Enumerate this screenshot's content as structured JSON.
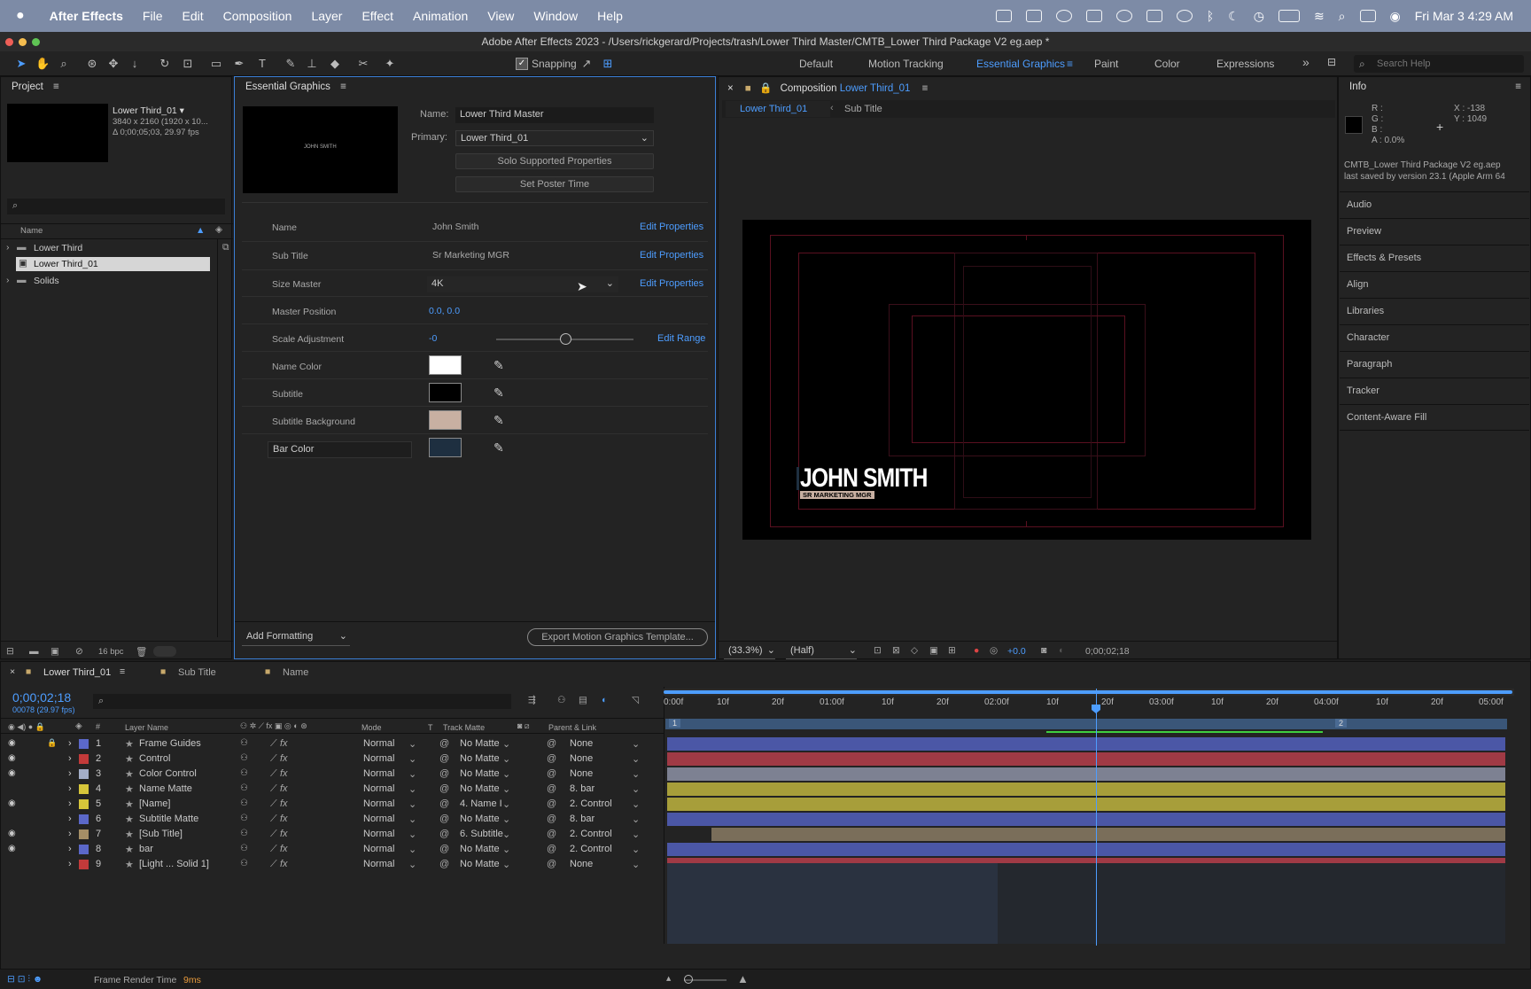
{
  "menubar": {
    "app_name": "After Effects",
    "items": [
      "File",
      "Edit",
      "Composition",
      "Layer",
      "Effect",
      "Animation",
      "View",
      "Window",
      "Help"
    ],
    "datetime": "Fri Mar 3  4:29 AM"
  },
  "window": {
    "title": "Adobe After Effects 2023 - /Users/rickgerard/Projects/trash/Lower Third Master/CMTB_Lower Third Package V2 eg.aep *"
  },
  "toolbar": {
    "snapping_label": "Snapping",
    "workspaces": [
      "Default",
      "Motion Tracking",
      "Essential Graphics",
      "Paint",
      "Color",
      "Expressions"
    ],
    "active_workspace": "Essential Graphics",
    "search_placeholder": "Search Help"
  },
  "project": {
    "title": "Project",
    "selected_name": "Lower Third_01 ▾",
    "selected_res": "3840 x 2160  (1920 x 10...",
    "selected_dur": "Δ 0;00;05;03, 29.97 fps",
    "col_name": "Name",
    "items": [
      {
        "name": "Lower Third",
        "kind": "folder"
      },
      {
        "name": "Lower Third_01",
        "kind": "comp"
      },
      {
        "name": "Solids",
        "kind": "folder"
      }
    ],
    "bpc": "16 bpc"
  },
  "essential_graphics": {
    "title": "Essential Graphics",
    "name_label": "Name:",
    "name_value": "Lower Third Master",
    "primary_label": "Primary:",
    "primary_value": "Lower Third_01",
    "solo_button": "Solo Supported Properties",
    "poster_button": "Set Poster Time",
    "thumb_text": "JOHN SMITH",
    "edit_properties": "Edit Properties",
    "edit_range": "Edit Range",
    "rows": [
      {
        "label": "Name",
        "value": "John Smith"
      },
      {
        "label": "Sub Title",
        "value": "Sr Marketing MGR"
      },
      {
        "label": "Size Master",
        "value": "4K"
      },
      {
        "label": "Master Position",
        "value": "0.0, 0.0"
      },
      {
        "label": "Scale Adjustment",
        "value": "-0"
      },
      {
        "label": "Name Color",
        "value": ""
      },
      {
        "label": "Subtitle",
        "value": ""
      },
      {
        "label": "Subtitle Background",
        "value": ""
      },
      {
        "label": "Bar Color",
        "value": ""
      }
    ],
    "scale_adjustment_fraction": 0.5,
    "colors": {
      "name_color": "#ffffff",
      "subtitle": "#000000",
      "subtitle_bg": "#c8b0a2",
      "bar": "#1e2f40"
    },
    "add_formatting": "Add Formatting",
    "export_button": "Export Motion Graphics Template..."
  },
  "composition": {
    "title_prefix": "Composition",
    "title_comp": "Lower Third_01",
    "breadcrumb_active": "Lower Third_01",
    "breadcrumb_next": "Sub Title",
    "name_text": "JOHN SMITH",
    "subtitle_text": "SR MARKETING MGR",
    "zoom": "(33.3%)",
    "resolution": "(Half)",
    "exposure": "+0.0",
    "timecode": "0;00;02;18"
  },
  "info": {
    "title": "Info",
    "r": "R :",
    "g": "G :",
    "b": "B :",
    "a": "A :  0.0%",
    "x": "X : -138",
    "y": "Y : 1049",
    "file": "CMTB_Lower Third Package V2 eg.aep",
    "saved": "last saved by version 23.1 (Apple Arm 64",
    "panels": [
      "Audio",
      "Preview",
      "Effects & Presets",
      "Align",
      "Libraries",
      "Character",
      "Paragraph",
      "Tracker",
      "Content-Aware Fill"
    ]
  },
  "timeline": {
    "tabs": [
      "Lower Third_01",
      "Sub Title",
      "Name"
    ],
    "timecode": "0;00;02;18",
    "frame_info": "00078 (29.97 fps)",
    "headers": {
      "num": "#",
      "layer_name": "Layer Name",
      "mode": "Mode",
      "t": "T",
      "track_matte": "Track Matte",
      "parent": "Parent & Link"
    },
    "ruler": [
      "0:00f",
      "10f",
      "20f",
      "01:00f",
      "10f",
      "20f",
      "02:00f",
      "10f",
      "20f",
      "03:00f",
      "10f",
      "20f",
      "04:00f",
      "10f",
      "20f",
      "05:00f"
    ],
    "markers": [
      "1",
      "2"
    ],
    "layers": [
      {
        "num": "1",
        "name": "Frame Guides",
        "mode": "Normal",
        "matte": "No Matte",
        "parent": "None",
        "color": "#5b68c9",
        "bar": "#4b57a6"
      },
      {
        "num": "2",
        "name": "Control",
        "mode": "Normal",
        "matte": "No Matte",
        "parent": "None",
        "color": "#c23a3a",
        "bar": "#a03a45"
      },
      {
        "num": "3",
        "name": "Color Control",
        "mode": "Normal",
        "matte": "No Matte",
        "parent": "None",
        "color": "#a3adc7",
        "bar": "#7d8192"
      },
      {
        "num": "4",
        "name": "Name Matte",
        "mode": "Normal",
        "matte": "No Matte",
        "parent": "8. bar",
        "color": "#d6c53a",
        "bar": "#a79e3a"
      },
      {
        "num": "5",
        "name": "[Name]",
        "mode": "Normal",
        "matte": "4. Name I",
        "parent": "2. Control",
        "color": "#d6c53a",
        "bar": "#a79e3a"
      },
      {
        "num": "6",
        "name": "Subtitle Matte",
        "mode": "Normal",
        "matte": "No Matte",
        "parent": "8. bar",
        "color": "#5b68c9",
        "bar": "#4b57a6"
      },
      {
        "num": "7",
        "name": "[Sub Title]",
        "mode": "Normal",
        "matte": "6. Subtitle",
        "parent": "2. Control",
        "color": "#a58e66",
        "bar": "#7a6e5a"
      },
      {
        "num": "8",
        "name": "bar",
        "mode": "Normal",
        "matte": "No Matte",
        "parent": "2. Control",
        "color": "#5b68c9",
        "bar": "#4b57a6"
      },
      {
        "num": "9",
        "name": "[Light ... Solid 1]",
        "mode": "Normal",
        "matte": "No Matte",
        "parent": "None",
        "color": "#c23a3a",
        "bar": "#a03a45"
      }
    ],
    "render_label": "Frame Render Time",
    "render_value": "9ms"
  }
}
